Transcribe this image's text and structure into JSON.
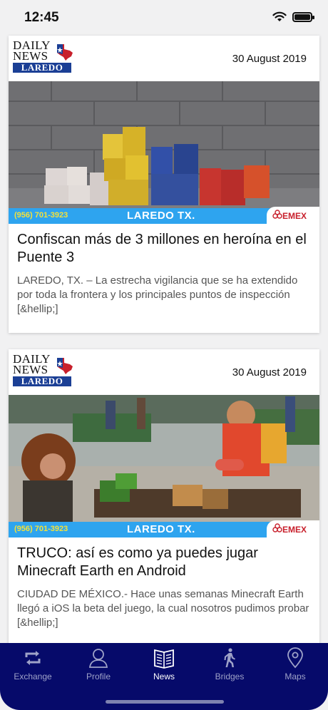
{
  "status_bar": {
    "time": "12:45"
  },
  "articles": [
    {
      "logo": {
        "line1": "DAILY",
        "line2": "NEWS",
        "bar": "LAREDO"
      },
      "date": "30 August 2019",
      "ticker_phone": "(956) 701-3923",
      "ticker_city": "LAREDO TX.",
      "emex": "EMEX",
      "title": "Confiscan más de 3 millones en heroína en el Puente 3",
      "excerpt": "LAREDO, TX. – La estrecha vigilancia que se ha extendido por toda la frontera y los principales puntos de inspección [&hellip;]"
    },
    {
      "logo": {
        "line1": "DAILY",
        "line2": "NEWS",
        "bar": "LAREDO"
      },
      "date": "30 August 2019",
      "ticker_phone": "(956) 701-3923",
      "ticker_city": "LAREDO TX.",
      "emex": "EMEX",
      "title": "TRUCO: así es como ya puedes jugar Minecraft Earth en Android",
      "excerpt": "CIUDAD DE MÉXICO.- Hace unas semanas Minecraft Earth llegó a iOS la beta del juego, la cual nosotros pudimos probar [&hellip;]"
    }
  ],
  "tab_bar": {
    "items": [
      {
        "label": "Exchange",
        "icon": "exchange-icon"
      },
      {
        "label": "Profile",
        "icon": "profile-icon"
      },
      {
        "label": "News",
        "icon": "news-icon",
        "active": true
      },
      {
        "label": "Bridges",
        "icon": "walking-person-icon"
      },
      {
        "label": "Maps",
        "icon": "map-pin-icon"
      }
    ],
    "background": "#060a6a",
    "active_color": "#ffffff",
    "inactive_color": "#9ea2c8"
  }
}
